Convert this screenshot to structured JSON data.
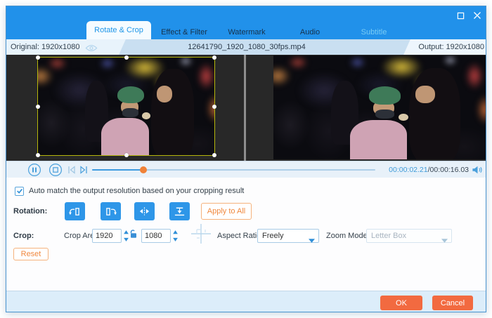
{
  "tabs": [
    {
      "label": "Rotate & Crop",
      "active": true
    },
    {
      "label": "Effect & Filter",
      "active": false
    },
    {
      "label": "Watermark",
      "active": false
    },
    {
      "label": "Audio",
      "active": false
    },
    {
      "label": "Subtitle",
      "active": false,
      "muted": true
    }
  ],
  "info_bar": {
    "original_label": "Original: 1920x1080",
    "filename": "12641790_1920_1080_30fps.mp4",
    "output_label": "Output: 1920x1080"
  },
  "player": {
    "current_time": "00:00:02.21",
    "separator": "/",
    "total_time": "00:00:16.03",
    "progress_percent": 18
  },
  "options": {
    "auto_match_label": "Auto match the output resolution based on your cropping result",
    "auto_match_checked": true
  },
  "rotation": {
    "label": "Rotation:",
    "apply_all_label": "Apply to All"
  },
  "crop": {
    "label": "Crop:",
    "area_label": "Crop Area:",
    "width_value": "1920",
    "height_value": "1080",
    "aspect_label": "Aspect Ratio:",
    "aspect_value": "Freely",
    "zoom_label": "Zoom Mode:",
    "zoom_value": "Letter Box",
    "zoom_disabled": true,
    "reset_label": "Reset"
  },
  "footer": {
    "ok_label": "OK",
    "cancel_label": "Cancel"
  },
  "icons": {
    "window": [
      "maximize-icon",
      "close-icon"
    ],
    "info_bar": [
      "eye-icon"
    ],
    "player": [
      "pause-icon",
      "stop-icon",
      "previous-frame-icon",
      "next-frame-icon",
      "volume-icon"
    ],
    "rotation": [
      "rotate-left-icon",
      "rotate-right-icon",
      "flip-horizontal-icon",
      "flip-vertical-icon"
    ],
    "crop": [
      "lock-open-icon",
      "spinner-icon",
      "crop-position-crosshair-icon",
      "chevron-down-icon"
    ]
  },
  "colors": {
    "titlebar_blue": "#2191ea",
    "accent_blue": "#2e96e8",
    "subtitle_tab_text": "#79ccf5",
    "info_bar_band": "#c9dff1",
    "crop_border_yellow": "#b5b60c",
    "slider_fill": "#3f9be0",
    "slider_handle_orange": "#f08238",
    "orange_button": "#f26a40",
    "outline_button_text": "#f0883e",
    "footer_bg": "#dcedfa",
    "video_bg": "#282828"
  }
}
